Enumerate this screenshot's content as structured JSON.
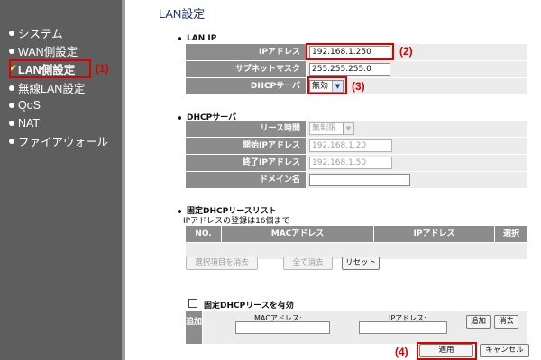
{
  "sidebar": {
    "items": [
      {
        "label": "システム",
        "marker": "dot"
      },
      {
        "label": "WAN側設定",
        "marker": "dot"
      },
      {
        "label": "LAN側設定",
        "marker": "check",
        "active": true
      },
      {
        "label": "無線LAN設定",
        "marker": "dot"
      },
      {
        "label": "QoS",
        "marker": "dot"
      },
      {
        "label": "NAT",
        "marker": "dot"
      },
      {
        "label": "ファイアウォール",
        "marker": "dot"
      }
    ],
    "callout": "(1)"
  },
  "page": {
    "title": "LAN設定"
  },
  "lan_ip": {
    "heading": "LAN IP",
    "ip_label": "IPアドレス",
    "ip_value": "192.168.1.250",
    "ip_callout": "(2)",
    "mask_label": "サブネットマスク",
    "mask_value": "255.255.255.0",
    "dhcp_label": "DHCPサーバ",
    "dhcp_value": "無効",
    "dhcp_callout": "(3)"
  },
  "dhcp_server": {
    "heading": "DHCPサーバ",
    "lease_label": "リース時間",
    "lease_value": "無制限",
    "start_label": "開始IPアドレス",
    "start_value": "192.168.1.20",
    "end_label": "終了IPアドレス",
    "end_value": "192.168.1.50",
    "domain_label": "ドメイン名",
    "domain_value": ""
  },
  "fixed_list": {
    "heading": "固定DHCPリースリスト",
    "note": "IPアドレスの登録は16個まで",
    "columns": [
      "NO.",
      "MACアドレス",
      "IPアドレス",
      "選択"
    ],
    "buttons": {
      "delete_selected": "選択項目を消去",
      "delete_all": "全て消去",
      "reset": "リセット"
    }
  },
  "enable_fixed": {
    "label": "固定DHCPリースを有効",
    "add_label": "追加",
    "mac_label": "MACアドレス:",
    "ip_label": "IPアドレス:",
    "add_button": "追加",
    "clear_button": "消去"
  },
  "footer": {
    "apply": "適用",
    "cancel": "キャンセル",
    "apply_callout": "(4)"
  },
  "colors": {
    "sidebar": "#5e5e5e",
    "label_cell": "#8c8c8c",
    "callout": "#d90000",
    "title": "#1a2f80"
  }
}
